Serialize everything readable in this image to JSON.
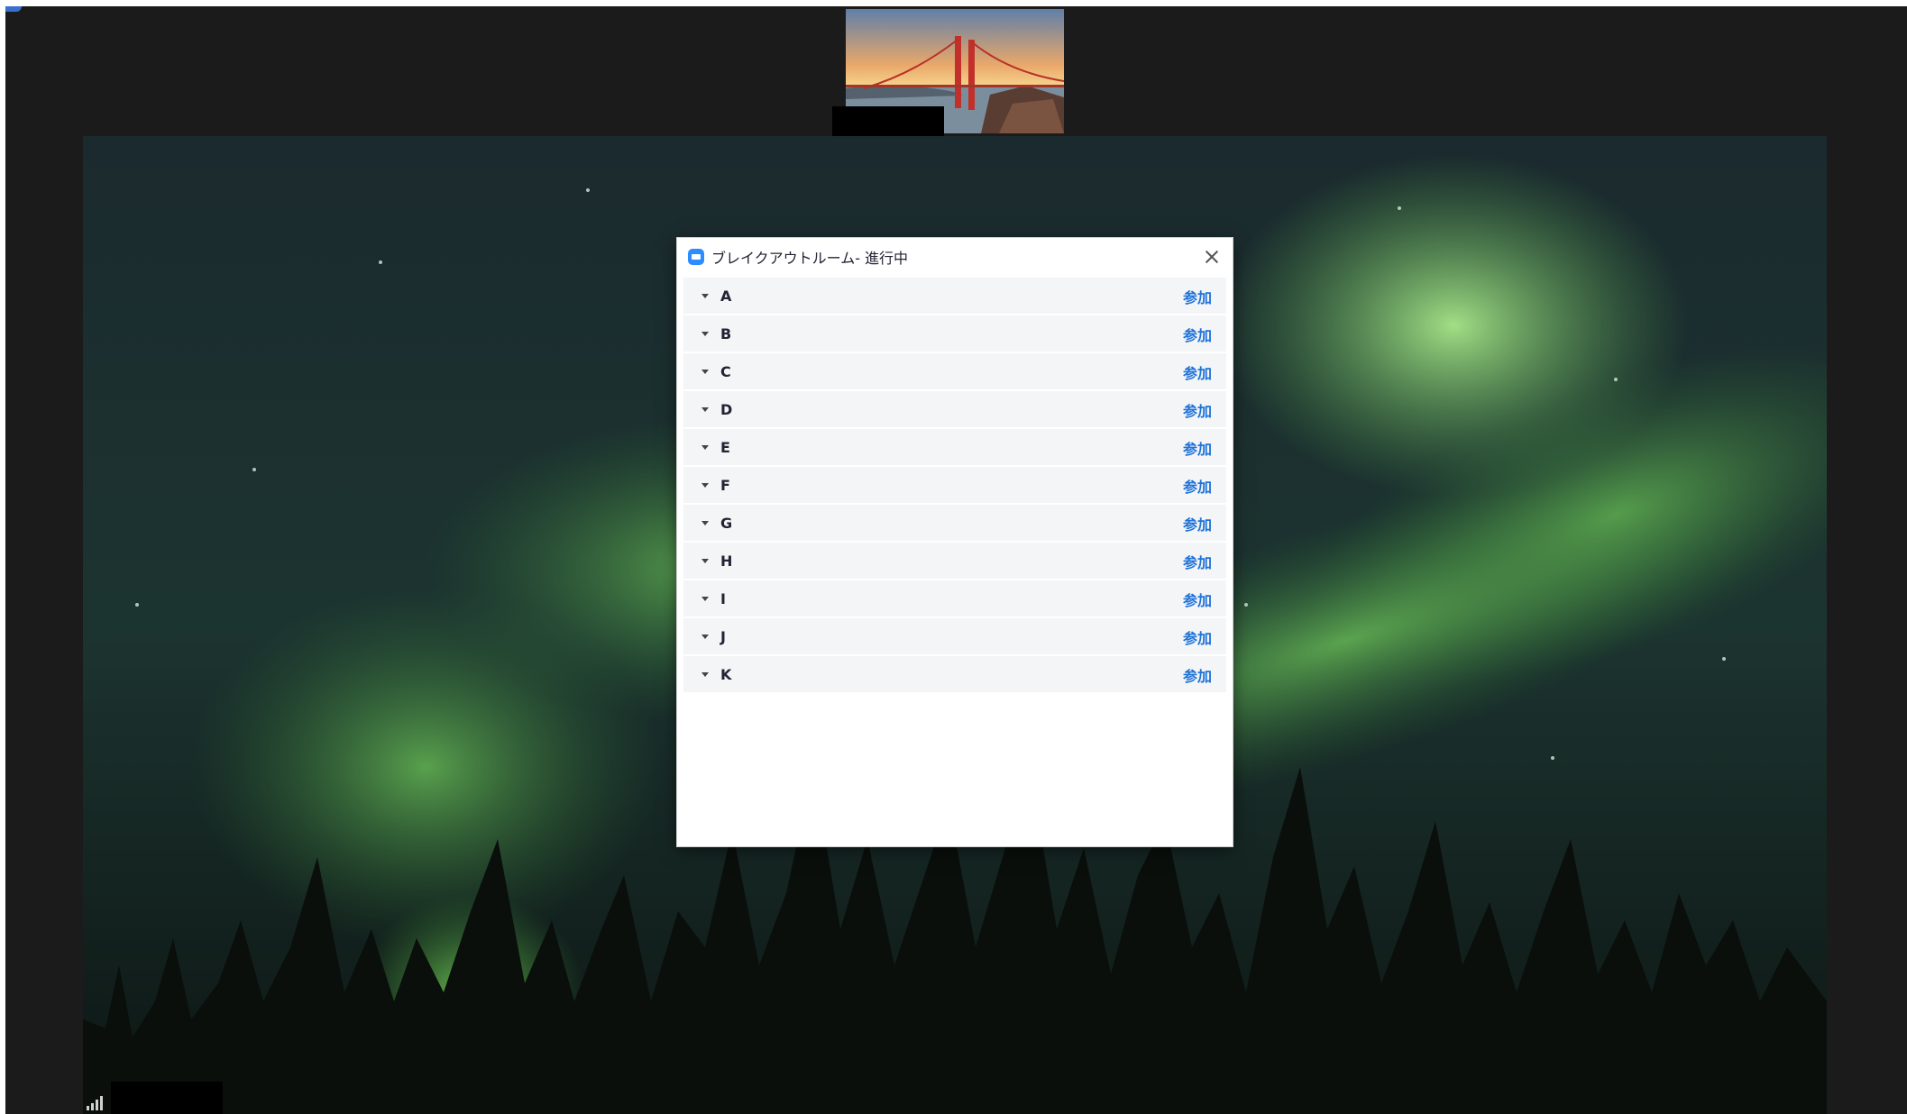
{
  "dialog": {
    "title": "ブレイクアウトルーム- 進行中",
    "close_icon": "close-icon",
    "app_icon": "zoom-app-icon",
    "rooms": [
      {
        "name": "A",
        "action": "参加"
      },
      {
        "name": "B",
        "action": "参加"
      },
      {
        "name": "C",
        "action": "参加"
      },
      {
        "name": "D",
        "action": "参加"
      },
      {
        "name": "E",
        "action": "参加"
      },
      {
        "name": "F",
        "action": "参加"
      },
      {
        "name": "G",
        "action": "参加"
      },
      {
        "name": "H",
        "action": "参加"
      },
      {
        "name": "I",
        "action": "参加"
      },
      {
        "name": "J",
        "action": "参加"
      },
      {
        "name": "K",
        "action": "参加"
      }
    ]
  },
  "colors": {
    "accent": "#2d8cff",
    "link": "#1f73d9",
    "row_background": "#f4f5f7",
    "frame_background": "#1b1b1b"
  },
  "icons": {
    "room_expand": "chevron-down-icon",
    "connection": "signal-icon"
  }
}
